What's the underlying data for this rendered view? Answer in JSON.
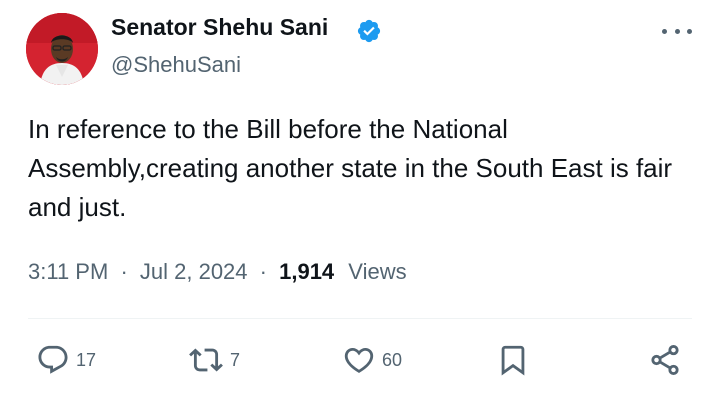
{
  "author": {
    "display_name": "Senator Shehu Sani",
    "handle": "@ShehuSani",
    "verified": true,
    "avatar_icon": "avatar"
  },
  "tweet": {
    "text": "In reference to the Bill before the National Assembly,creating another state in the South East is fair and just.",
    "time": "3:11 PM",
    "separator": "·",
    "date": "Jul 2, 2024",
    "views_count": "1,914",
    "views_label": "Views"
  },
  "actions": {
    "replies": "17",
    "reposts": "7",
    "likes": "60",
    "reply_icon": "reply-icon",
    "repost_icon": "repost-icon",
    "like_icon": "heart-icon",
    "bookmark_icon": "bookmark-icon",
    "share_icon": "share-icon"
  },
  "colors": {
    "text_primary": "#0f1419",
    "text_secondary": "#536471",
    "verified_blue": "#1d9bf0",
    "divider": "#eff3f4"
  }
}
